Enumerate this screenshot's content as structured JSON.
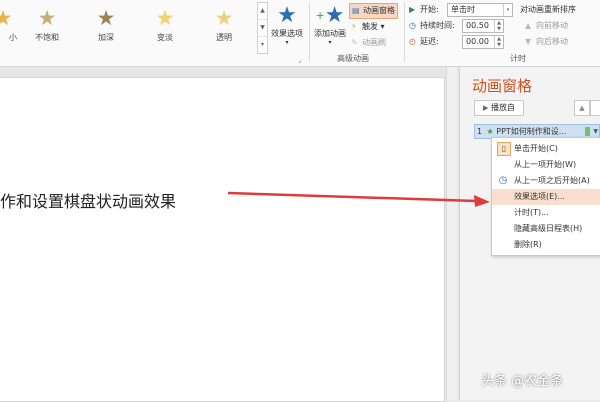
{
  "ribbon": {
    "effects": [
      {
        "label": "小",
        "color": "#e6b54c",
        "partial": true
      },
      {
        "label": "不饱和",
        "color": "#c7ad76"
      },
      {
        "label": "加深",
        "color": "#9d8550"
      },
      {
        "label": "变淡",
        "color": "#f1cf73"
      },
      {
        "label": "透明",
        "color": "#efcf82"
      }
    ],
    "effect_options_label": "效果选项",
    "add_animation_label": "添加动画",
    "animation_pane_label": "动画窗格",
    "trigger_label": "触发",
    "animation_painter_label": "动画刷",
    "advanced_group_label": "高级动画",
    "start_label": "开始:",
    "start_value": "单击时",
    "duration_label": "持续时间:",
    "duration_value": "00.50",
    "delay_label": "延迟:",
    "delay_value": "00.00",
    "reorder_label": "对动画重新排序",
    "move_earlier_label": "向前移动",
    "move_later_label": "向后移动",
    "timing_group_label": "计时"
  },
  "slide": {
    "text": "作和设置棋盘状动画效果"
  },
  "pane": {
    "title": "动画窗格",
    "play_label": "播放自",
    "item_number": "1",
    "item_label": "PPT如何制作和设..."
  },
  "menu": {
    "items": [
      {
        "label": "单击开始(C)",
        "icon": "mouse-icon"
      },
      {
        "label": "从上一项开始(W)",
        "icon": ""
      },
      {
        "label": "从上一项之后开始(A)",
        "icon": "clock-icon"
      },
      {
        "label": "效果选项(E)...",
        "icon": ""
      },
      {
        "label": "计时(T)...",
        "icon": ""
      },
      {
        "label": "隐藏高级日程表(H)",
        "icon": ""
      },
      {
        "label": "删除(R)",
        "icon": ""
      }
    ]
  },
  "colors": {
    "accent": "#d2501f",
    "arrow": "#e03a3a",
    "highlight": "#f9dfcd",
    "selection": "#cfe0f3"
  },
  "watermark": "头条 @农金条"
}
